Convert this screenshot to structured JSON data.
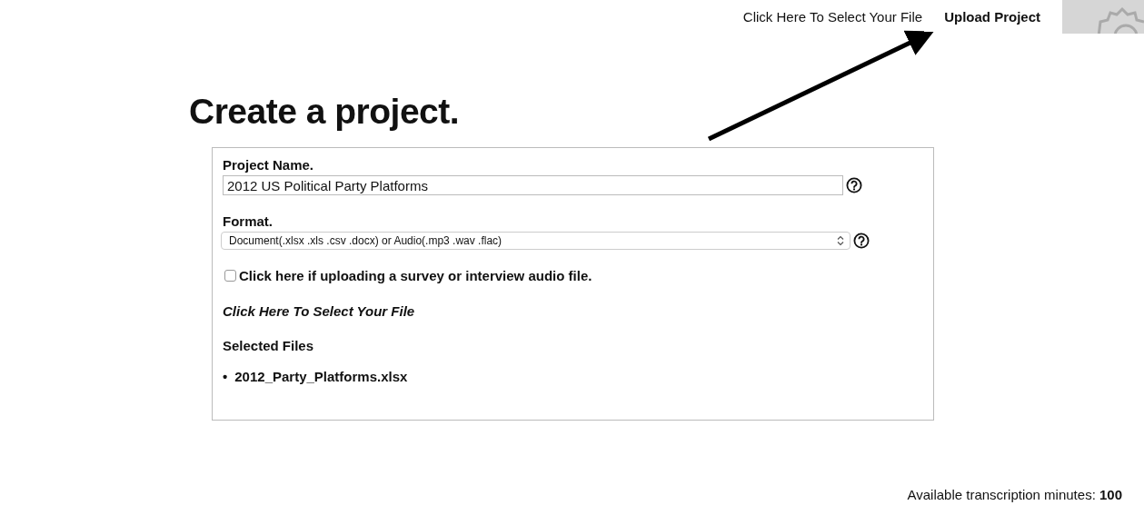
{
  "top_nav": {
    "links": [
      {
        "label": "Click Here To Select Your File",
        "bold": false
      },
      {
        "label": "Upload Project",
        "bold": true
      }
    ]
  },
  "heading": "Create a project.",
  "form": {
    "project_name": {
      "label": "Project Name.",
      "value": "2012 US Political Party Platforms"
    },
    "format": {
      "label": "Format.",
      "value": "Document(.xlsx .xls .csv .docx) or Audio(.mp3 .wav .flac)"
    },
    "survey_checkbox": {
      "label": "Click here if uploading a survey or interview audio file.",
      "checked": false
    },
    "select_file_link": "Click Here To Select Your File",
    "selected_files": {
      "title": "Selected Files",
      "files": [
        {
          "marker": "•",
          "name": "2012_Party_Platforms.xlsx"
        }
      ]
    }
  },
  "footer": "Available transcription minutes: **100**"
}
